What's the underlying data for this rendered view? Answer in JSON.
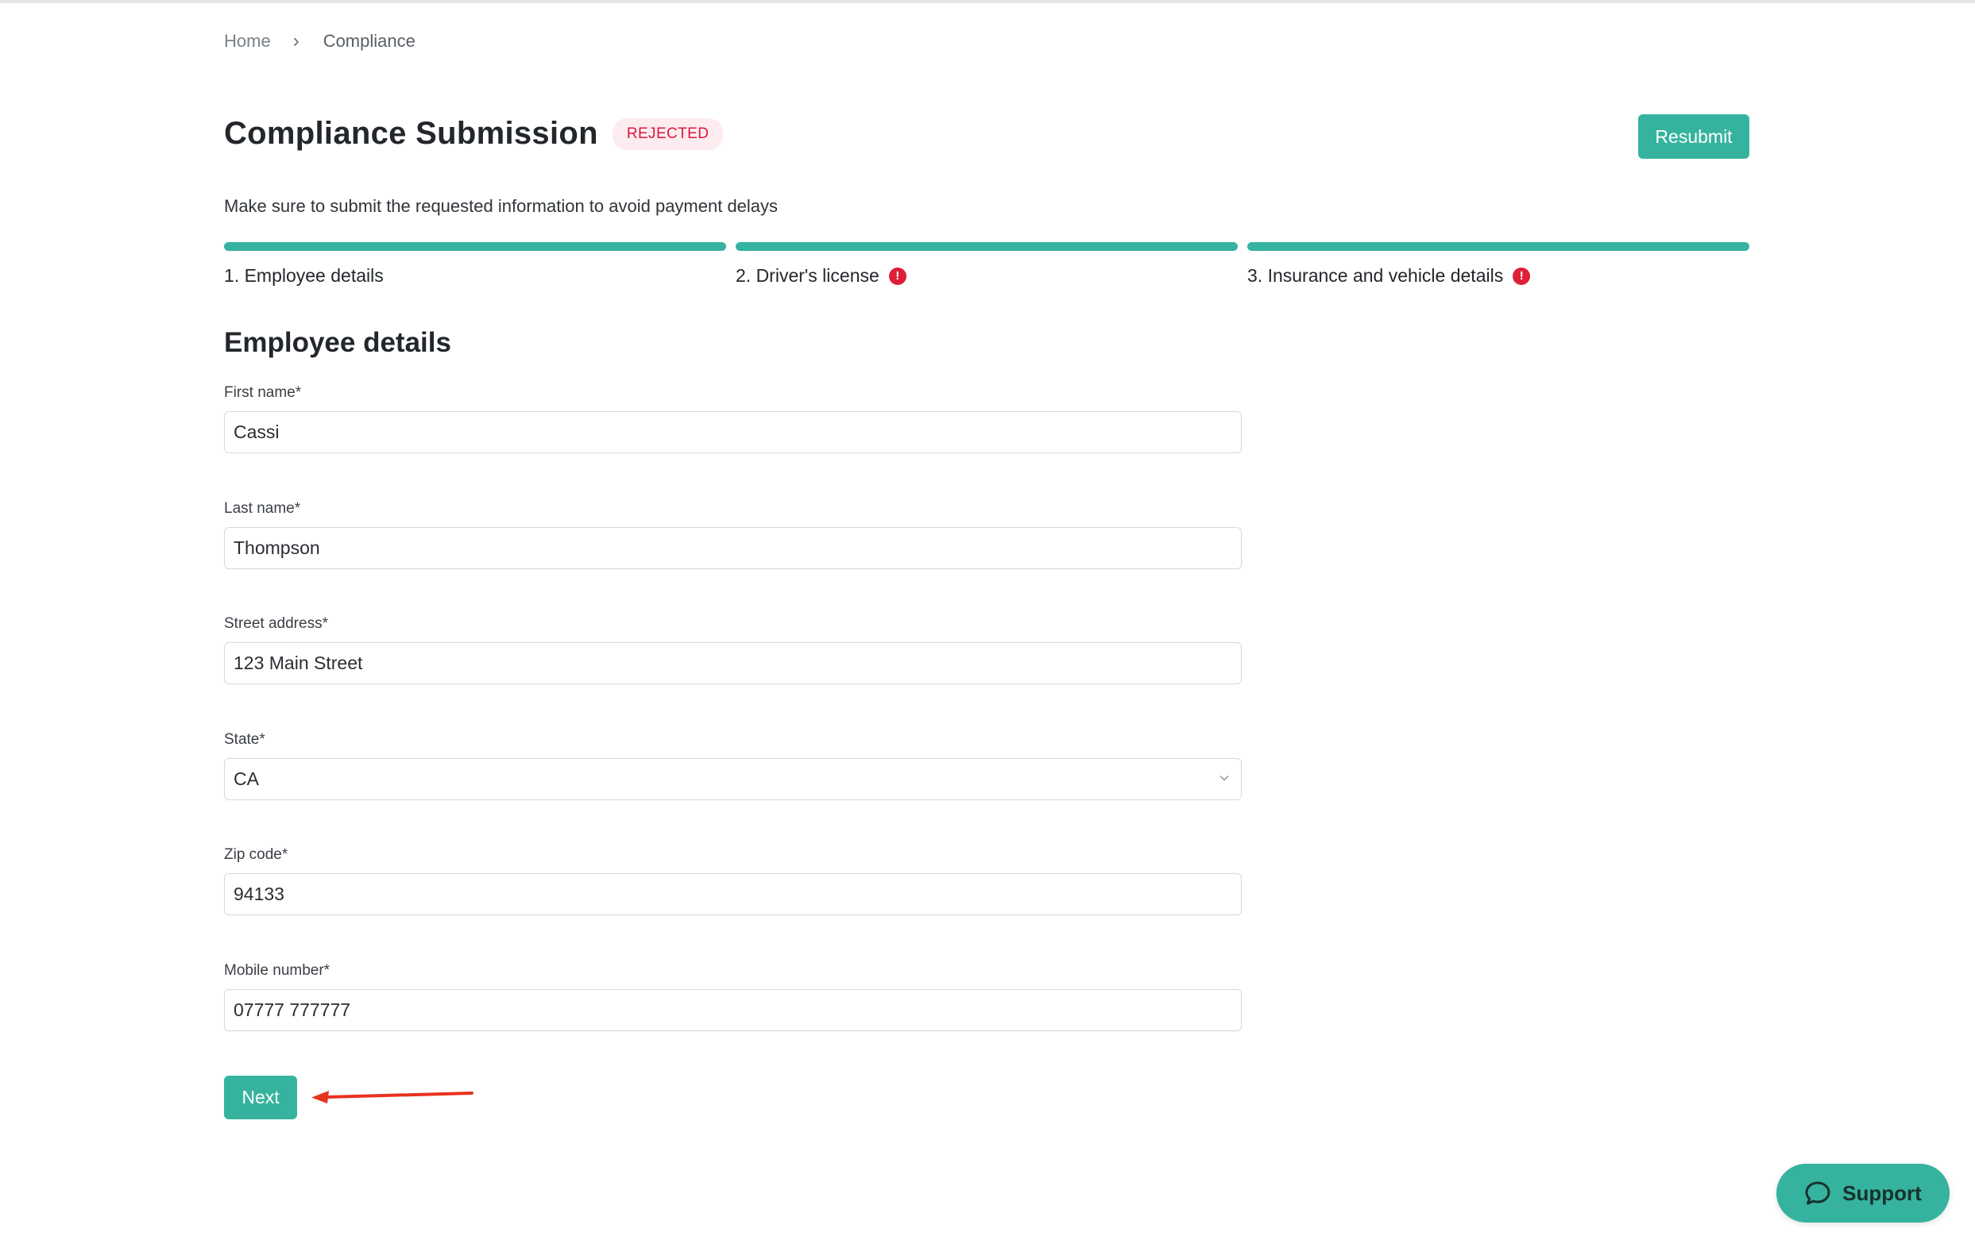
{
  "breadcrumb": {
    "home": "Home",
    "separator": "›",
    "current": "Compliance"
  },
  "page": {
    "title": "Compliance Submission",
    "status_badge": "REJECTED",
    "resubmit_label": "Resubmit",
    "subtitle": "Make sure to submit the requested information to avoid payment delays"
  },
  "steps": [
    {
      "label": "1. Employee details",
      "warning": false
    },
    {
      "label": "2. Driver's license",
      "warning": true
    },
    {
      "label": "3. Insurance and vehicle details",
      "warning": true
    }
  ],
  "form": {
    "section_title": "Employee details",
    "first_name": {
      "label": "First name*",
      "value": "Cassi"
    },
    "last_name": {
      "label": "Last name*",
      "value": "Thompson"
    },
    "street_address": {
      "label": "Street address*",
      "value": "123 Main Street"
    },
    "state": {
      "label": "State*",
      "value": "CA"
    },
    "zip_code": {
      "label": "Zip code*",
      "value": "94133"
    },
    "mobile_number": {
      "label": "Mobile number*",
      "value": "07777 777777"
    },
    "next_label": "Next"
  },
  "support": {
    "label": "Support"
  },
  "colors": {
    "accent": "#35b39e",
    "rejected_text": "#d7193d",
    "rejected_bg": "#fdecef",
    "warning": "#dd1f38",
    "annotation_arrow": "#e8321f"
  },
  "icons": {
    "warning": "exclamation-circle-icon",
    "chevron": "chevron-down-icon",
    "support": "chat-bubble-icon",
    "annotation": "red-arrow-annotation"
  }
}
